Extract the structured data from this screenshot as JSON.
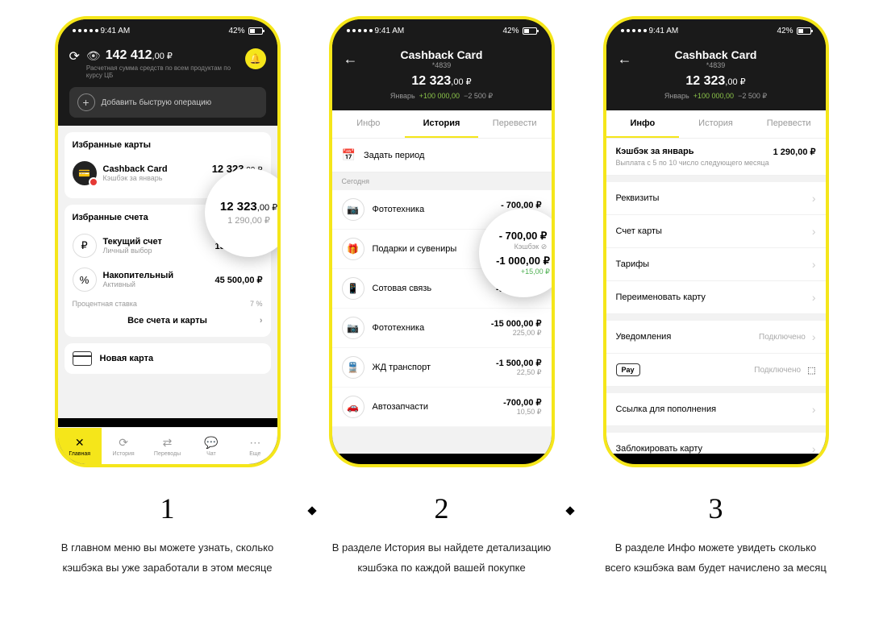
{
  "status": {
    "time": "9:41 AM",
    "battery": "42%"
  },
  "p1": {
    "balance_main": "142 412",
    "balance_dec": ",00 ₽",
    "balance_sub": "Расчетная сумма средств по всем продуктам по курсу ЦБ",
    "quick_add": "Добавить быструю операцию",
    "sec1_title": "Избранные карты",
    "card_name": "Cashback Card",
    "card_sub": "Кэшбэк за январь",
    "card_amt": "12 323",
    "card_amt_d": ",00 ₽",
    "card_cb": "1 290,00 ₽",
    "sec2_title": "Избранные счета",
    "acc1_name": "Текущий счет",
    "acc1_sub": "Личный выбор",
    "acc1_amt": "15 000,00 ₽",
    "acc2_name": "Накопительный",
    "acc2_sub": "Активный",
    "acc2_amt": "45 500,00 ₽",
    "rate_lbl": "Процентная ставка",
    "rate_val": "7 %",
    "all_link": "Все счета и карты",
    "new_card": "Новая карта",
    "tabs": [
      "Главная",
      "История",
      "Переводы",
      "Чат",
      "Еще"
    ],
    "zoom_amt": "12 323",
    "zoom_amt_d": ",00 ₽",
    "zoom_cb": "1 290,00 ₽"
  },
  "p2": {
    "title": "Cashback Card",
    "sub": "*4839",
    "bal": "12 323",
    "bal_d": ",00 ₽",
    "month": "Январь",
    "pos": "+100 000,00",
    "neg": "−2 500 ₽",
    "tabs": [
      "Инфо",
      "История",
      "Перевести"
    ],
    "period": "Задать период",
    "day": "Сегодня",
    "tx": [
      {
        "ico": "📷",
        "name": "Фототехника",
        "amt": "- 700,00 ₽",
        "cb": "Кэшбэк ⊘"
      },
      {
        "ico": "🎁",
        "name": "Подарки и сувениры",
        "amt": "-1 000,00 ₽",
        "cb": "+15,00 ₽"
      },
      {
        "ico": "📱",
        "name": "Сотовая связь",
        "amt": "-9 000,00 ₽",
        "cb": ""
      },
      {
        "ico": "📷",
        "name": "Фототехника",
        "amt": "-15 000,00 ₽",
        "cb": "225,00 ₽"
      },
      {
        "ico": "🚆",
        "name": "ЖД транспорт",
        "amt": "-1 500,00 ₽",
        "cb": "22,50 ₽"
      },
      {
        "ico": "🚗",
        "name": "Автозапчасти",
        "amt": "-700,00 ₽",
        "cb": "10,50 ₽"
      }
    ],
    "z1_a": "- 700,00 ₽",
    "z1_c": "Кэшбэк ⊘",
    "z2_a": "-1 000,00 ₽",
    "z2_c": "+15,00 ₽"
  },
  "p3": {
    "title": "Cashback Card",
    "sub": "*4839",
    "bal": "12 323",
    "bal_d": ",00 ₽",
    "month": "Январь",
    "pos": "+100 000,00",
    "neg": "−2 500 ₽",
    "tabs": [
      "Инфо",
      "История",
      "Перевести"
    ],
    "cb_name": "Кэшбэк за январь",
    "cb_amt": "1 290,00 ₽",
    "cb_sub": "Выплата с 5 по 10 число следующего месяца",
    "rows": [
      "Реквизиты",
      "Счет карты",
      "Тарифы",
      "Переименовать карту"
    ],
    "notif": "Уведомления",
    "notif_v": "Подключено",
    "apay": "Pay",
    "apay_v": "Подключено",
    "link": "Ссылка для пополнения",
    "block": "Заблокировать карту"
  },
  "caps": [
    {
      "n": "1",
      "t": "В главном меню вы можете узнать, сколько кэшбэка вы уже заработали в этом месяце"
    },
    {
      "n": "2",
      "t": "В разделе История вы найдете детализацию кэшбэка по каждой вашей покупке"
    },
    {
      "n": "3",
      "t": "В разделе Инфо можете увидеть сколько всего кэшбэка вам будет начислено за месяц"
    }
  ]
}
